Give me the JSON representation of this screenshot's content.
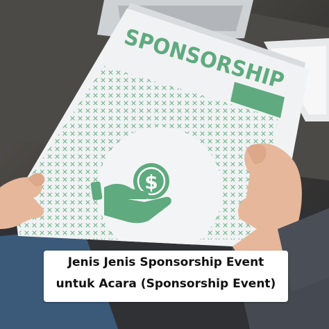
{
  "image": {
    "document_heading": "SPONSORSHIP",
    "icon": "hand-holding-dollar-coin-icon",
    "coin_symbol": "$",
    "accent_color": "#5faa7f"
  },
  "caption": {
    "line1": "Jenis Jenis Sponsorship Event",
    "line2": "untuk Acara (Sponsorship Event)"
  }
}
